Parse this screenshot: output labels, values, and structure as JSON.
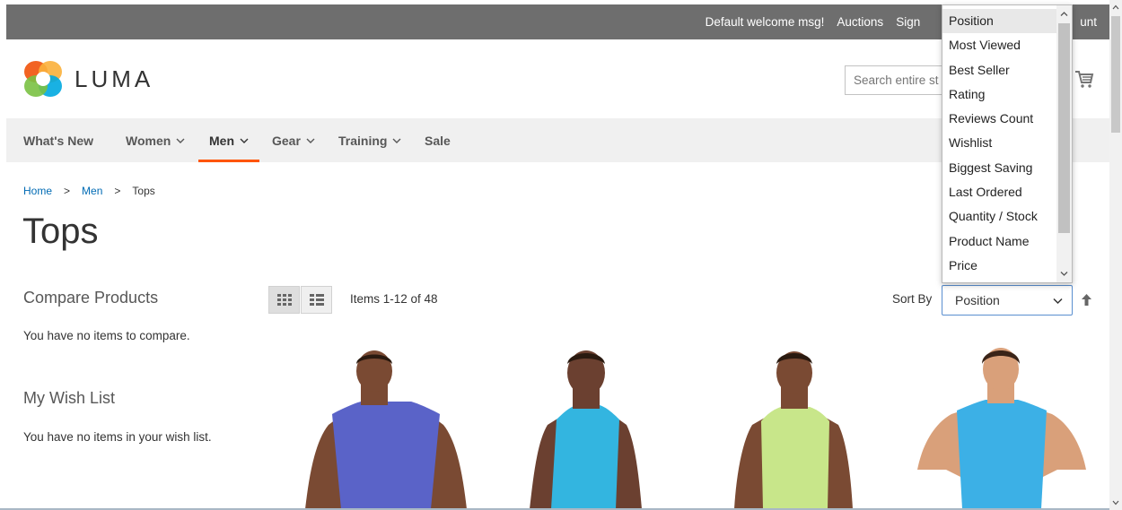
{
  "topbar": {
    "welcome": "Default welcome msg!",
    "auctions": "Auctions",
    "sign_in": "Sign",
    "account": "unt"
  },
  "header": {
    "logo_text": "LUMA",
    "search_placeholder": "Search entire st",
    "brand_colors": [
      "#f26322",
      "#fbb03b",
      "#00a9e0",
      "#7ac143",
      "#e2247a"
    ]
  },
  "nav": {
    "items": [
      {
        "label": "What's New",
        "has_dropdown": false
      },
      {
        "label": "Women",
        "has_dropdown": true
      },
      {
        "label": "Men",
        "has_dropdown": true,
        "active": true
      },
      {
        "label": "Gear",
        "has_dropdown": true
      },
      {
        "label": "Training",
        "has_dropdown": true
      },
      {
        "label": "Sale",
        "has_dropdown": false
      }
    ],
    "active_color": "#ff5501"
  },
  "breadcrumb": {
    "home": "Home",
    "sep1": ">",
    "men": "Men",
    "sep2": ">",
    "current": "Tops"
  },
  "page_title": "Tops",
  "sidebar": {
    "compare_title": "Compare Products",
    "compare_empty": "You have no items to compare.",
    "wishlist_title": "My Wish List",
    "wishlist_empty": "You have no items in your wish list."
  },
  "toolbar": {
    "grid_icon": "grid-view-icon",
    "list_icon": "list-view-icon",
    "amount": "Items 1-12 of 48",
    "sort_label": "Sort By",
    "sort_value": "Position",
    "sort_direction_icon": "arrow-up-icon"
  },
  "sort_dropdown": {
    "options": [
      "Position",
      "Most Viewed",
      "Best Seller",
      "Rating",
      "Reviews Count",
      "Wishlist",
      "Biggest Saving",
      "Last Ordered",
      "Quantity / Stock",
      "Product Name",
      "Price"
    ],
    "selected": "Position"
  },
  "products": [
    {
      "shirt_color": "#5a63c8"
    },
    {
      "shirt_color": "#33b5e0"
    },
    {
      "shirt_color": "#c8e68a"
    },
    {
      "shirt_color": "#3cb0e6"
    }
  ]
}
